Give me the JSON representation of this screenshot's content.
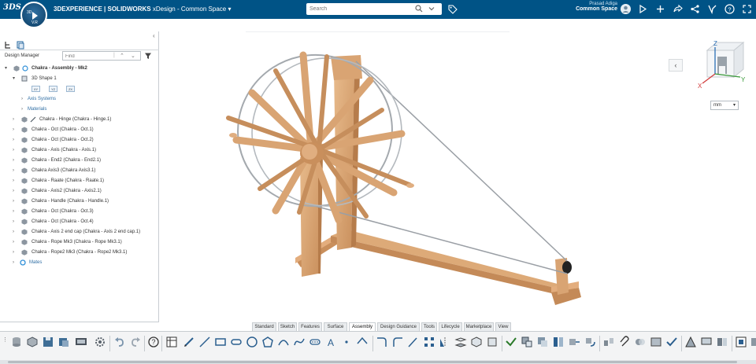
{
  "topbar": {
    "logo": "3DS",
    "compass": {
      "top_left": "3D",
      "top_right": "",
      "bottom": "V.R"
    },
    "brand": "3DEXPERIENCE",
    "app_name": "| SOLIDWORKS",
    "context": "xDesign - Common Space",
    "search_placeholder": "Search",
    "user_name": "Prasad Adiga",
    "space_name": "Common Space"
  },
  "left_panel": {
    "design_manager_label": "Design Manager",
    "find_placeholder": "Find",
    "tree": [
      {
        "label": "Chakra - Assembly - Mk2",
        "bold": true
      },
      {
        "label": "3D Shape 1"
      },
      {
        "chips": [
          "XY",
          "YZ",
          "ZX"
        ]
      },
      {
        "label": "Axis Systems",
        "link": true
      },
      {
        "label": "Materials",
        "link": true
      },
      {
        "label": "Chakra - Hinge (Chakra - Hinge.1)"
      },
      {
        "label": "Chakra - Oct (Chakra - Oct.1)"
      },
      {
        "label": "Chakra - Oct (Chakra - Oct.2)"
      },
      {
        "label": "Chakra - Axis (Chakra - Axis.1)"
      },
      {
        "label": "Chakra - End2 (Chakra - End2.1)"
      },
      {
        "label": "Chakra Axis3 (Chakra Axis3.1)"
      },
      {
        "label": "Chakra - Raate (Chakra - Raate.1)"
      },
      {
        "label": "Chakra - Axis2 (Chakra - Axis2.1)"
      },
      {
        "label": "Chakra - Handle (Chakra - Handle.1)"
      },
      {
        "label": "Chakra - Oct (Chakra - Oct.3)"
      },
      {
        "label": "Chakra - Oct (Chakra - Oct.4)"
      },
      {
        "label": "Chakra - Axis 2 end cap (Chakra - Axis 2 end cap.1)"
      },
      {
        "label": "Chakra - Rope Mk3 (Chakra - Rope Mk3.1)"
      },
      {
        "label": "Chakra - Rope2 Mk3 (Chakra - Rope2 Mk3.1)"
      },
      {
        "label": "Mates",
        "link": true
      }
    ]
  },
  "viewport": {
    "back_label": "‹",
    "unit": "mm",
    "axes": {
      "x": "X",
      "y": "Y",
      "z": "Z"
    }
  },
  "action_bar": {
    "tabs": [
      "Standard",
      "Sketch",
      "Features",
      "Surface",
      "Assembly",
      "Design Guidance",
      "Tools",
      "Lifecycle",
      "Marketplace",
      "View"
    ],
    "active_tab": "Assembly"
  },
  "colors": {
    "topbar": "#005386",
    "wood": "#dcaa7a",
    "wood_dark": "#c48a58",
    "rope": "#9a9fa5"
  }
}
